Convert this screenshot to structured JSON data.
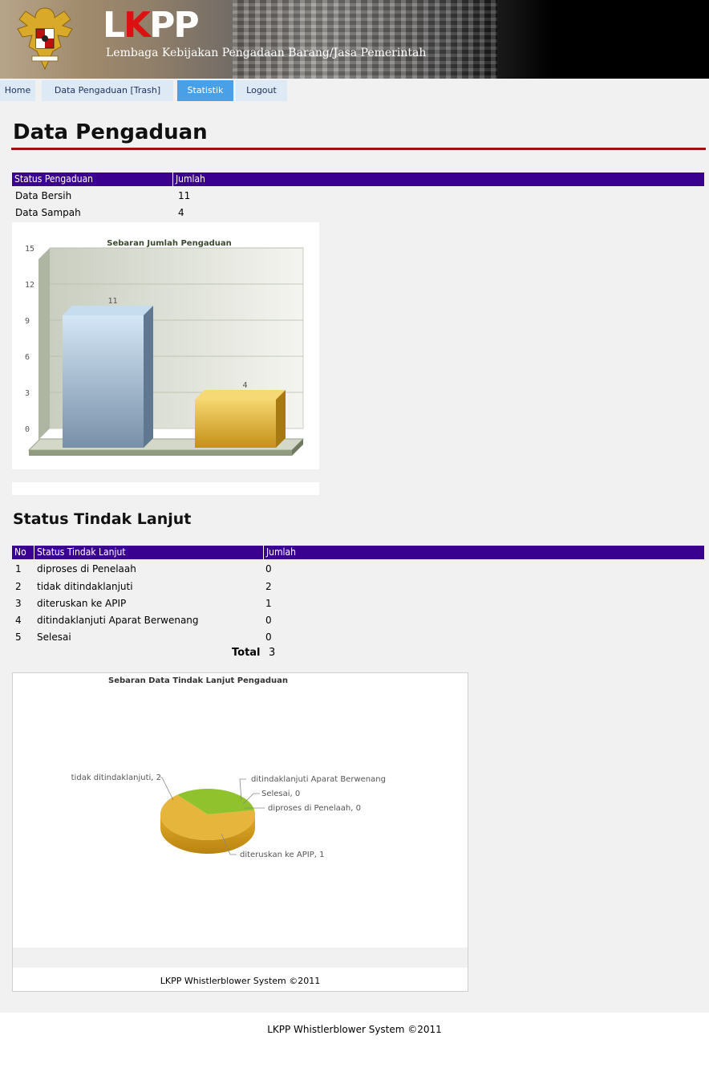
{
  "header": {
    "logo": "LKPP",
    "subtitle": "Lembaga Kebijakan Pengadaan Barang/Jasa Pemerintah"
  },
  "nav": {
    "items": [
      {
        "label": "Home",
        "active": false
      },
      {
        "label": "Data Pengaduan [Trash]",
        "active": false
      },
      {
        "label": "Statistik",
        "active": true
      },
      {
        "label": "Logout",
        "active": false
      }
    ]
  },
  "main": {
    "title": "Data Pengaduan",
    "status_table": {
      "headers": [
        "Status Pengaduan",
        "Jumlah"
      ],
      "rows": [
        {
          "status": "Data Bersih",
          "count": "11"
        },
        {
          "status": "Data Sampah",
          "count": "4"
        }
      ]
    },
    "tindak_title": "Status Tindak Lanjut",
    "tindak_table": {
      "headers": [
        "No",
        "Status Tindak Lanjut",
        "Jumlah"
      ],
      "rows": [
        {
          "no": "1",
          "status": "diproses di Penelaah",
          "count": "0"
        },
        {
          "no": "2",
          "status": "tidak ditindaklanjuti",
          "count": "2"
        },
        {
          "no": "3",
          "status": "diteruskan ke APIP",
          "count": "1"
        },
        {
          "no": "4",
          "status": "ditindaklanjuti Aparat Berwenang",
          "count": "0"
        },
        {
          "no": "5",
          "status": "Selesai",
          "count": "0"
        }
      ],
      "total_label": "Total",
      "total_value": "3"
    }
  },
  "chart_data": [
    {
      "type": "bar",
      "title": "Sebaran Jumlah Pengaduan",
      "categories": [
        "Data Bersih",
        "Data Sampah"
      ],
      "values": [
        11,
        4
      ],
      "data_labels": [
        "11",
        "4"
      ],
      "ylim": [
        0,
        15
      ],
      "yticks": [
        "0",
        "3",
        "6",
        "9",
        "12",
        "15"
      ],
      "grid": true,
      "colors": [
        "#a9c4df",
        "#e2b53a"
      ]
    },
    {
      "type": "pie",
      "title": "Sebaran Data Tindak Lanjut Pengaduan",
      "slices": [
        {
          "label": "diproses di Penelaah, 0",
          "value": 0
        },
        {
          "label": "tidak ditindaklanjuti, 2",
          "value": 2
        },
        {
          "label": "diteruskan ke APIP, 1",
          "value": 1
        },
        {
          "label": "ditindaklanjuti Aparat Berwenang",
          "value": 0
        },
        {
          "label": "Selesai, 0",
          "value": 0
        }
      ],
      "colors": {
        "tidak ditindaklanjuti": "#e6b53b",
        "diteruskan ke APIP": "#8fc22d"
      }
    }
  ],
  "footer": {
    "inner": "LKPP Whistlerblower System ©2011",
    "outer": "LKPP Whistlerblower System ©2011"
  }
}
